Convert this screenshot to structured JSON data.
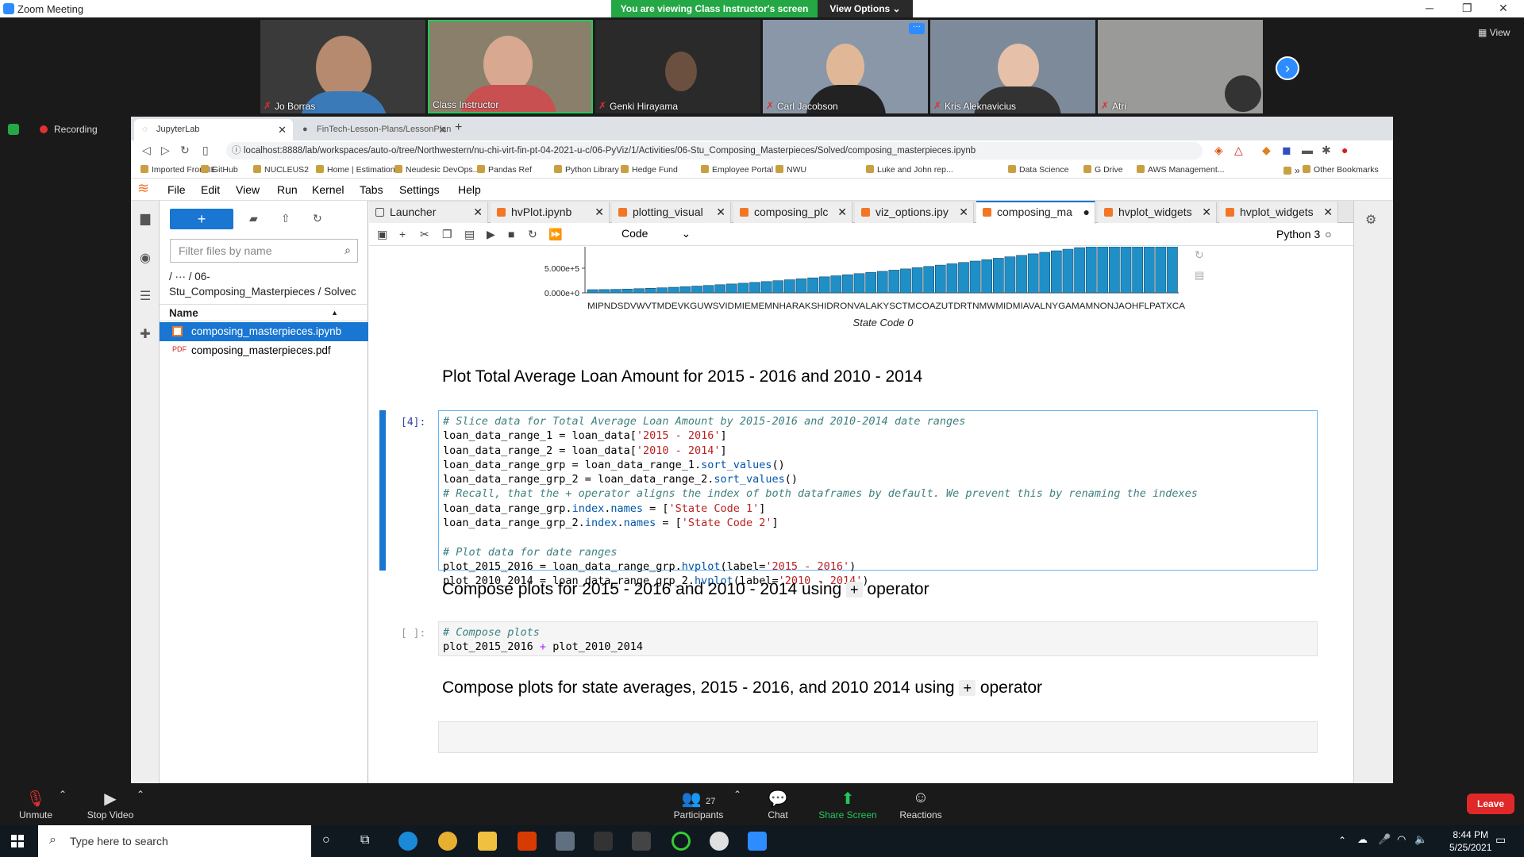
{
  "zoom": {
    "title": "Zoom Meeting",
    "banner": "You are viewing Class Instructor's screen",
    "view_options": "View Options ⌄",
    "view": "View",
    "recording": "Recording",
    "participants": [
      {
        "name": "Jo Borras"
      },
      {
        "name": "Class Instructor"
      },
      {
        "name": "Genki Hirayama"
      },
      {
        "name": "Carl Jacobson"
      },
      {
        "name": "Kris Aleknavicius"
      },
      {
        "name": "Atri"
      }
    ],
    "controls": {
      "unmute": "Unmute",
      "stop_video": "Stop Video",
      "participants": "Participants",
      "participant_count": "27",
      "chat": "Chat",
      "share": "Share Screen",
      "reactions": "Reactions",
      "leave": "Leave"
    }
  },
  "browser": {
    "tabs": [
      "JupyterLab",
      "FinTech-Lesson-Plans/LessonPlan"
    ],
    "url": "localhost:8888/lab/workspaces/auto-o/tree/Northwestern/nu-chi-virt-fin-pt-04-2021-u-c/06-PyViz/1/Activities/06-Stu_Composing_Masterpieces/Solved/composing_masterpieces.ipynb",
    "bookmarks": [
      "Imported From IE",
      "GitHub",
      "NUCLEUS2",
      "Home | Estimation...",
      "Neudesic DevOps...",
      "Pandas Ref",
      "Python Library",
      "Hedge Fund",
      "Employee Portal",
      "NWU",
      "Luke and John rep...",
      "Data Science",
      "G Drive",
      "AWS Management..."
    ],
    "more": "»",
    "other_bookmarks": "Other Bookmarks"
  },
  "jupyter": {
    "menu": [
      "File",
      "Edit",
      "View",
      "Run",
      "Kernel",
      "Tabs",
      "Settings",
      "Help"
    ],
    "filter_placeholder": "Filter files by name",
    "breadcrumb_1": "/ ··· / 06-",
    "breadcrumb_2": "Stu_Composing_Masterpieces / Solvec",
    "name_header": "Name",
    "files": [
      "composing_masterpieces.ipynb",
      "composing_masterpieces.pdf"
    ],
    "doc_tabs": [
      "Launcher",
      "hvPlot.ipynb",
      "plotting_visual",
      "composing_plc",
      "viz_options.ipy",
      "composing_ma",
      "hvplot_widgets",
      "hvplot_widgets"
    ],
    "cell_type": "Code",
    "kernel": "Python 3",
    "chart": {
      "y_ticks": [
        "5.000e+5",
        "0.000e+0"
      ],
      "x_tick_text": "MIPNDSDVWVTMDEVKGUWSVIDMIEMEMNHARAKSHIDRONVALAKYSCTMCOAZUTDRTNMWMIDMIAVALNYGAMAMNONJAOHFLPATXCA",
      "xlabel": "State Code 0",
      "bar_count": 51
    },
    "headings": {
      "h1": "Plot Total Average Loan Amount for 2015 - 2016 and 2010 - 2014",
      "h2_pre": "Compose plots for 2015 - 2016 and 2010 - 2014 using",
      "h3_pre": "Compose plots for state averages, 2015 - 2016, and 2010 2014 using",
      "op": "+",
      "op_post": "operator"
    },
    "prompts": {
      "p1": "[4]:",
      "p2": "[ ]:"
    },
    "code1": {
      "c1": "# Slice data for Total Average Loan Amount by 2015-2016 and 2010-2014 date ranges",
      "c2": "# Recall, that the + operator aligns the index of both dataframes by default. We prevent this by renaming the indexes",
      "c3": "# Plot data for date ranges"
    },
    "code2": {
      "c1": "# Compose plots"
    }
  },
  "taskbar": {
    "search": "Type here to search",
    "time": "8:44 PM",
    "date": "5/25/2021"
  }
}
